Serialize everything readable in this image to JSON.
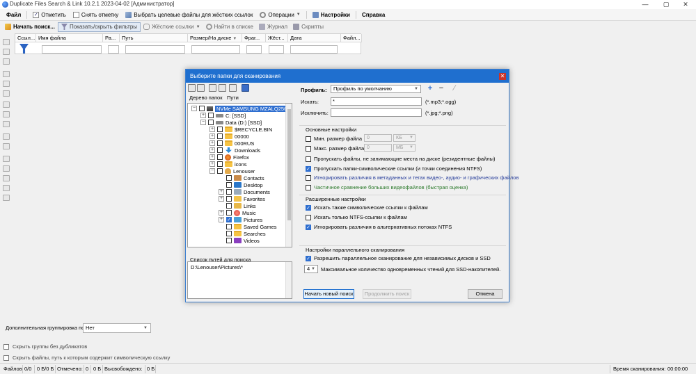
{
  "window": {
    "title": "Duplicate Files Search & Link 10.2.1 2023-04-02 [Администратор]",
    "minimize": "—",
    "maximize": "▢",
    "close": "✕"
  },
  "menu": {
    "file": "Файл",
    "mark": "Отметить",
    "unmark": "Снять отметку",
    "select_targets": "Выбрать целевые файлы для жёстких ссылок",
    "operations": "Операции",
    "settings": "Настройки",
    "help": "Справка"
  },
  "toolbar": {
    "start_search": "Начать поиск...",
    "toggle_filters": "Показать/скрыть фильтры",
    "hard_links": "Жёсткие ссылки",
    "find_in_list": "Найти в списке",
    "journal": "Журнал",
    "scripts": "Скрипты"
  },
  "grid": {
    "columns": [
      "Ссыл...",
      "Имя файла",
      "Ра...",
      "Путь",
      "Размер/На диске",
      "Фраг...",
      "Жёст...",
      "Дата",
      "Файл..."
    ]
  },
  "dialog": {
    "title": "Выберите папки для сканирования",
    "tabs": {
      "tree": "Дерево папок",
      "paths": "Пути"
    },
    "tree": [
      {
        "label": "NVMe SAMSUNG MZALQ256HBJD",
        "expander": "−",
        "checked": false,
        "icon": "disk",
        "highlight": true
      },
      {
        "label": "C: [SSD]",
        "expander": "+",
        "checked": false,
        "icon": "drive"
      },
      {
        "label": "Data (D:) [SSD]",
        "expander": "−",
        "checked": false,
        "icon": "drive"
      },
      {
        "label": "$RECYCLE.BIN",
        "expander": "+",
        "checked": false,
        "icon": "folder"
      },
      {
        "label": "00000",
        "expander": "+",
        "checked": false,
        "icon": "folder"
      },
      {
        "label": "000RUS",
        "expander": "+",
        "checked": false,
        "icon": "folder"
      },
      {
        "label": "Downloads",
        "expander": "+",
        "checked": false,
        "icon": "download"
      },
      {
        "label": "Firefox",
        "expander": "+",
        "checked": false,
        "icon": "firefox"
      },
      {
        "label": "icons",
        "expander": "+",
        "checked": false,
        "icon": "folder"
      },
      {
        "label": "Lenouser",
        "expander": "−",
        "checked": false,
        "icon": "user"
      },
      {
        "label": "Contacts",
        "expander": "",
        "checked": false,
        "icon": "contacts"
      },
      {
        "label": "Desktop",
        "expander": "",
        "checked": false,
        "icon": "desktop"
      },
      {
        "label": "Documents",
        "expander": "+",
        "checked": false,
        "icon": "docs"
      },
      {
        "label": "Favorites",
        "expander": "+",
        "checked": false,
        "icon": "fav"
      },
      {
        "label": "Links",
        "expander": "",
        "checked": false,
        "icon": "links"
      },
      {
        "label": "Music",
        "expander": "+",
        "checked": false,
        "icon": "music"
      },
      {
        "label": "Pictures",
        "expander": "+",
        "checked": true,
        "icon": "pics"
      },
      {
        "label": "Saved Games",
        "expander": "",
        "checked": false,
        "icon": "folder"
      },
      {
        "label": "Searches",
        "expander": "",
        "checked": false,
        "icon": "folder"
      },
      {
        "label": "Videos",
        "expander": "",
        "checked": false,
        "icon": "video"
      }
    ],
    "path_list": {
      "label": "Список путей для поиска",
      "value": "D:\\Lenouser\\Pictures\\*"
    },
    "profile": {
      "label": "Профиль:",
      "value": "Профиль по умолчанию"
    },
    "search": {
      "label": "Искать:",
      "value": "*",
      "hint": "(*.mp3;*.ogg)"
    },
    "exclude": {
      "label": "Исключить:",
      "value": "",
      "hint": "(*.jpg;*.png)"
    },
    "basic": {
      "title": "Основные настройки",
      "min_size": {
        "label": "Мин. размер файла",
        "value": "0",
        "unit": "КБ",
        "checked": false
      },
      "max_size": {
        "label": "Макс. размер файла",
        "value": "0",
        "unit": "МБ",
        "checked": false
      },
      "skip_resident": {
        "label": "Пропускать файлы, не занимающие места на диске (резидентные файлы)",
        "checked": false
      },
      "skip_symlinks": {
        "label": "Пропускать папки-символические ссылки (и точки соединения NTFS)",
        "checked": true
      },
      "ignore_meta": {
        "label": "Игнорировать различия в метаданных и тегах видео-, аудио- и графических файлов",
        "checked": false
      },
      "partial_video": {
        "label": "Частичное сравнение больших видеофайлов (быстрая оценка)",
        "checked": false
      }
    },
    "advanced": {
      "title": "Расширенные настройки",
      "find_symlinks": {
        "label": "Искать также символические ссылки к файлам",
        "checked": true
      },
      "only_ntfs": {
        "label": "Искать только NTFS-ссылки к файлам",
        "checked": false
      },
      "ignore_streams": {
        "label": "Игнорировать различия в альтернативных потоках NTFS",
        "checked": true
      }
    },
    "parallel": {
      "title": "Настройки параллельного сканирования",
      "allow": {
        "label": "Разрешить параллельное сканирование для независимых дисков и SSD",
        "checked": true
      },
      "count": "4",
      "count_label": "Максимальное количество одновременных чтений для SSD-накопителей."
    },
    "buttons": {
      "start_new": "Начать новый поиск",
      "continue": "Продолжить поиск",
      "cancel": "Отмена"
    }
  },
  "bottom": {
    "grouping_label": "Дополнительная группировка по",
    "grouping_value": "Нет",
    "hide_groups": "Скрыть группы без дубликатов",
    "hide_symlink_path": "Скрыть файлы, путь к которым содержит символическую ссылку"
  },
  "status": {
    "files_label": "Файлов",
    "files_value": "0/0",
    "files_size": "0 Б/0 Б",
    "marked_label": "Отмечено:",
    "marked_count": "0",
    "marked_size": "0 Б",
    "freed_label": "Высвобождено:",
    "freed_value": "0 Б",
    "scan_time_label": "Время сканирования:",
    "scan_time_value": "00:00:00"
  },
  "colors": {
    "accent": "#1f6fcf",
    "checked": "#2f6fd0",
    "blue_text": "#233a99",
    "green_text": "#2c7a2c"
  }
}
